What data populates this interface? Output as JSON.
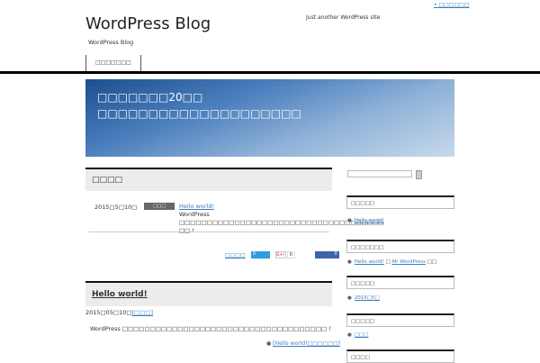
{
  "header": {
    "top_link": "□□□□□□",
    "title": "WordPress Blog",
    "tagline": "Just another WordPress site",
    "subtitle": "WordPress Blog",
    "nav": [
      "□□□□□□□"
    ]
  },
  "hero": {
    "line1": "□□□□□□□20□□",
    "line2": "□□□□□□□□□□□□□□□□□□□□"
  },
  "news": {
    "heading": "□□□□",
    "date": "2015□5□10□",
    "badge": "□□□",
    "link": "Hello world!",
    "excerpt": "WordPress □□□□□□□□□□□□□□□□□□□□□□□□□□□□□□□□□□□□□ □□ !"
  },
  "share": {
    "label": "□□□□",
    "twitter": "0",
    "gplus": "G+!",
    "gplus_count": "0",
    "facebook": "0"
  },
  "post": {
    "title": "Hello world!",
    "meta": "2015□05□10□",
    "category": "[□□□]",
    "excerpt": "WordPress □□□□□□□□□□□□□□□□□□□□□□□□□□□□□□□□□□□□□ !",
    "more": "[Hello world!□□□□□□]"
  },
  "sidebar": {
    "widgets": [
      {
        "title": "□□□□□",
        "items": [
          "Hello world!"
        ]
      },
      {
        "title": "□□□□□□□",
        "items": [
          "Hello world!"
        ],
        "extra": "□",
        "extra_link": "Mr WordPress",
        "extra2": "□□"
      },
      {
        "title": "□□□□□",
        "items": [
          "2015□5□"
        ]
      },
      {
        "title": "□□□□□",
        "items": [
          "□□□"
        ]
      },
      {
        "title": "□□□□",
        "items": []
      }
    ]
  }
}
